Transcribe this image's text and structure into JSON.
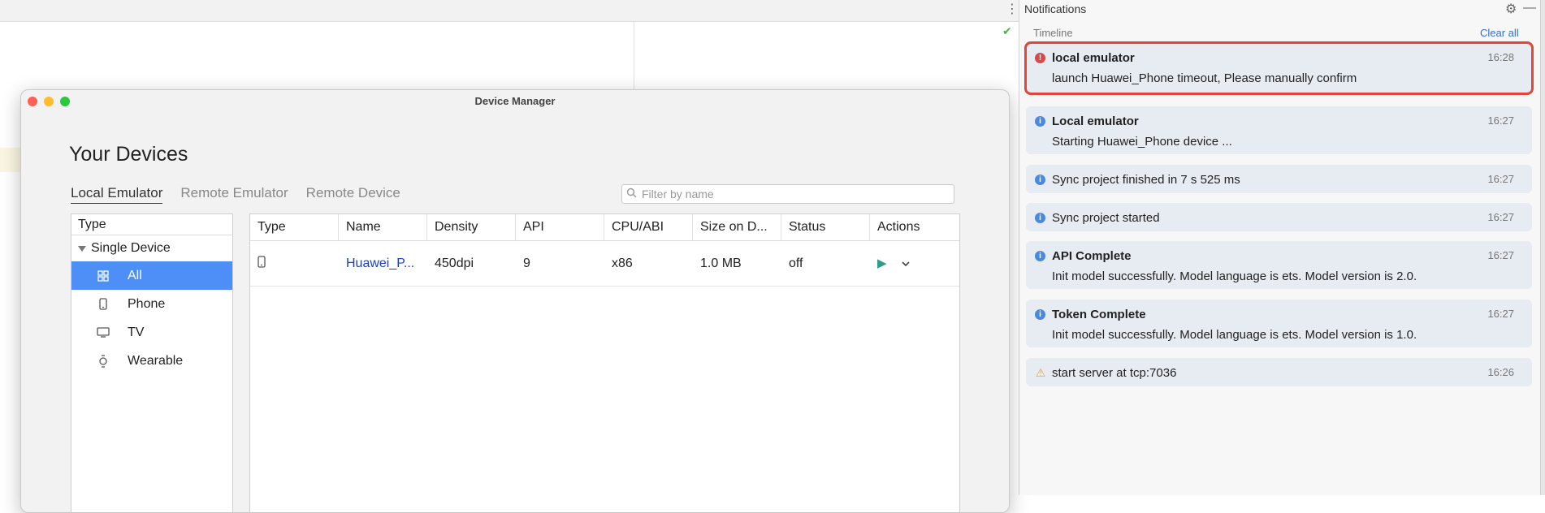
{
  "window": {
    "title": "Device Manager"
  },
  "heading": "Your Devices",
  "tabs": [
    {
      "label": "Local Emulator",
      "active": true
    },
    {
      "label": "Remote Emulator",
      "active": false
    },
    {
      "label": "Remote Device",
      "active": false
    }
  ],
  "filter": {
    "placeholder": "Filter by name",
    "value": ""
  },
  "type_panel": {
    "header": "Type",
    "group": "Single Device",
    "items": [
      {
        "label": "All",
        "icon": "grid-icon",
        "selected": true
      },
      {
        "label": "Phone",
        "icon": "phone-icon",
        "selected": false
      },
      {
        "label": "TV",
        "icon": "tv-icon",
        "selected": false
      },
      {
        "label": "Wearable",
        "icon": "watch-icon",
        "selected": false
      }
    ]
  },
  "table": {
    "columns": [
      "Type",
      "Name",
      "Density",
      "API",
      "CPU/ABI",
      "Size on D...",
      "Status",
      "Actions"
    ],
    "rows": [
      {
        "type_icon": "phone-icon",
        "name": "Huawei_P...",
        "density": "450dpi",
        "api": "9",
        "cpu": "x86",
        "size": "1.0 MB",
        "status": "off"
      }
    ]
  },
  "notifications": {
    "title": "Notifications",
    "timeline_label": "Timeline",
    "clear_all": "Clear all",
    "items": [
      {
        "level": "error",
        "title": "local emulator",
        "body": "launch Huawei_Phone timeout, Please manually confirm",
        "time": "16:28",
        "highlighted": true
      },
      {
        "level": "info",
        "title": "Local emulator",
        "body": "Starting Huawei_Phone device ...",
        "time": "16:27"
      },
      {
        "level": "info",
        "title": "Sync project finished in 7 s 525 ms",
        "time": "16:27"
      },
      {
        "level": "info",
        "title": "Sync project started",
        "time": "16:27"
      },
      {
        "level": "info",
        "title": "API Complete",
        "body": "Init model successfully. Model language is ets. Model version is 2.0.",
        "time": "16:27"
      },
      {
        "level": "info",
        "title": "Token Complete",
        "body": "Init model successfully. Model language is ets. Model version is 1.0.",
        "time": "16:27"
      },
      {
        "level": "warning",
        "title": "start server at tcp:7036",
        "time": "16:26"
      }
    ]
  },
  "colors": {
    "selection": "#4d8ff6",
    "link": "#1a3fc7",
    "play": "#2f9c8a",
    "highlight_border": "#e0463a",
    "card_bg": "#e7ebf2"
  }
}
